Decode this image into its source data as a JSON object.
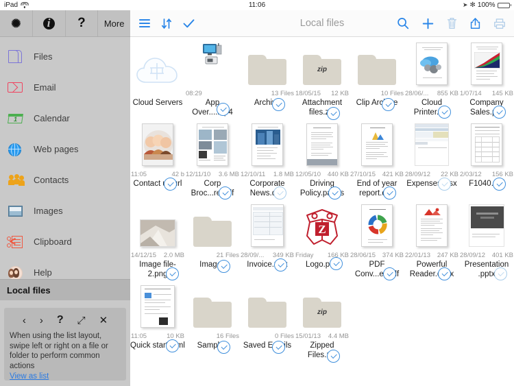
{
  "status_bar": {
    "device": "iPad",
    "wifi_icon": "wifi-icon",
    "time": "11:06",
    "location_icon": "location-arrow-icon",
    "bluetooth_icon": "bluetooth-icon",
    "battery_percent": "100%",
    "battery_icon": "battery-full-icon"
  },
  "sidebar": {
    "top_buttons": [
      {
        "name": "settings",
        "icon": "gear-icon",
        "label": "⚙"
      },
      {
        "name": "info",
        "icon": "info-icon",
        "label": "i"
      },
      {
        "name": "help",
        "icon": "question-mark-icon",
        "label": "?"
      },
      {
        "name": "more",
        "icon": "more-label",
        "label": "More"
      }
    ],
    "items": [
      {
        "label": "Files",
        "icon": "files-icon"
      },
      {
        "label": "Email",
        "icon": "email-icon"
      },
      {
        "label": "Calendar",
        "icon": "calendar-icon",
        "day": "1"
      },
      {
        "label": "Web pages",
        "icon": "globe-icon"
      },
      {
        "label": "Contacts",
        "icon": "contacts-icon"
      },
      {
        "label": "Images",
        "icon": "images-icon"
      },
      {
        "label": "Clipboard",
        "icon": "clipboard-icon"
      },
      {
        "label": "Help",
        "icon": "avatar-icon"
      }
    ],
    "section_header": "Local files",
    "tip": {
      "controls": [
        {
          "name": "prev",
          "glyph": "‹"
        },
        {
          "name": "next",
          "glyph": "›"
        },
        {
          "name": "help",
          "glyph": "?"
        },
        {
          "name": "expand",
          "glyph": "⤢"
        },
        {
          "name": "close",
          "glyph": "✕"
        }
      ],
      "text": "When using the list layout, swipe left or right on a file or folder to perform common actions",
      "link": "View as list"
    }
  },
  "toolbar": {
    "title": "Local files",
    "left": [
      {
        "name": "list-view",
        "icon": "hamburger-icon"
      },
      {
        "name": "sort",
        "icon": "sort-arrows-icon",
        "glyph": "↓↑"
      },
      {
        "name": "select",
        "icon": "checkmark-icon",
        "glyph": "✓"
      }
    ],
    "right": [
      {
        "name": "search",
        "icon": "search-icon",
        "enabled": true
      },
      {
        "name": "add",
        "icon": "plus-icon",
        "enabled": true
      },
      {
        "name": "delete",
        "icon": "trash-icon",
        "enabled": false
      },
      {
        "name": "share",
        "icon": "share-icon",
        "enabled": true
      },
      {
        "name": "print",
        "icon": "print-icon",
        "enabled": false
      }
    ]
  },
  "colors": {
    "accent": "#2a86e8",
    "accent_dim": "#b4cfe9",
    "sidebar_bg": "#c9c9c9",
    "sidebar_header_bg": "#b4b4b4",
    "folder": "#d9d5ca",
    "badge_border": "#3f8fdc",
    "meta_text": "#949494"
  },
  "files": [
    [
      {
        "name": "Cloud Servers",
        "meta_left": "",
        "meta_right": "",
        "kind": "cloud",
        "badge": "none"
      },
      {
        "name": "App Over....mp4",
        "meta_left": "08:29",
        "meta_right": "",
        "kind": "video",
        "badge": "on"
      },
      {
        "name": "Archive",
        "meta_left": "",
        "meta_right": "13 Files",
        "kind": "folder",
        "badge": "on"
      },
      {
        "name": "Attachment files.zip",
        "meta_left": "18/05/15",
        "meta_right": "12 KB",
        "kind": "folder-zip",
        "badge": "on"
      },
      {
        "name": "Clip Archive",
        "meta_left": "",
        "meta_right": "10 Files",
        "kind": "folder",
        "badge": "on"
      },
      {
        "name": "Cloud Printer.pdf",
        "meta_left": "28/06/...",
        "meta_right": "855 KB",
        "kind": "doc-cloudprint",
        "badge": "on"
      },
      {
        "name": "Company Sales.pdf",
        "meta_left": "1/07/14",
        "meta_right": "145 KB",
        "kind": "doc-chart",
        "badge": "on"
      }
    ],
    [
      {
        "name": "Contact us.url",
        "meta_left": "11:05",
        "meta_right": "42 b",
        "kind": "photo-people",
        "badge": "on"
      },
      {
        "name": "Corp Broc...re.pdf",
        "meta_left": "12/11/10",
        "meta_right": "3.6 MB",
        "kind": "doc-brochure",
        "badge": "on"
      },
      {
        "name": "Corporate News.doc",
        "meta_left": "12/10/11",
        "meta_right": "1.8 MB",
        "kind": "doc-news",
        "badge": "light"
      },
      {
        "name": "Driving Policy.pages",
        "meta_left": "12/05/10",
        "meta_right": "440 KB",
        "kind": "doc-text",
        "badge": "on"
      },
      {
        "name": "End of year report.doc",
        "meta_left": "27/10/15",
        "meta_right": "421 KB",
        "kind": "doc-report",
        "badge": "on"
      },
      {
        "name": "Expenses.xlsx",
        "meta_left": "28/09/12",
        "meta_right": "22 KB",
        "kind": "doc-sheet",
        "badge": "light"
      },
      {
        "name": "F1040.pdf",
        "meta_left": "2/03/12",
        "meta_right": "156 KB",
        "kind": "doc-form",
        "badge": "on"
      }
    ],
    [
      {
        "name": "Image file-2.png",
        "meta_left": "14/12/15",
        "meta_right": "2.0 MB",
        "kind": "photo-paper",
        "badge": "on"
      },
      {
        "name": "Images",
        "meta_left": "",
        "meta_right": "21 Files",
        "kind": "folder",
        "badge": "on"
      },
      {
        "name": "Invoice.xlsx",
        "meta_left": "28/09/...",
        "meta_right": "349 KB",
        "kind": "doc-invoice",
        "badge": "on"
      },
      {
        "name": "Logo.png",
        "meta_left": "Friday",
        "meta_right": "166 KB",
        "kind": "logo-owl",
        "badge": "on"
      },
      {
        "name": "PDF Conv...er.pdf",
        "meta_left": "28/06/15",
        "meta_right": "374 KB",
        "kind": "doc-wheel",
        "badge": "on"
      },
      {
        "name": "Powerful Reader.docx",
        "meta_left": "22/01/13",
        "meta_right": "247 KB",
        "kind": "doc-reader",
        "badge": "on"
      },
      {
        "name": "Presentation .pptx",
        "meta_left": "28/09/12",
        "meta_right": "401 KB",
        "kind": "doc-slide",
        "badge": "light"
      }
    ],
    [
      {
        "name": "Quick start.html",
        "meta_left": "11:05",
        "meta_right": "10 KB",
        "kind": "doc-html",
        "badge": "on"
      },
      {
        "name": "Samples",
        "meta_left": "",
        "meta_right": "16 Files",
        "kind": "folder",
        "badge": "on"
      },
      {
        "name": "Saved Emails",
        "meta_left": "",
        "meta_right": "0 Files",
        "kind": "folder",
        "badge": "on"
      },
      {
        "name": "Zipped Files.zip",
        "meta_left": "15/01/13",
        "meta_right": "4.4 MB",
        "kind": "folder-zip",
        "badge": "on"
      }
    ]
  ]
}
